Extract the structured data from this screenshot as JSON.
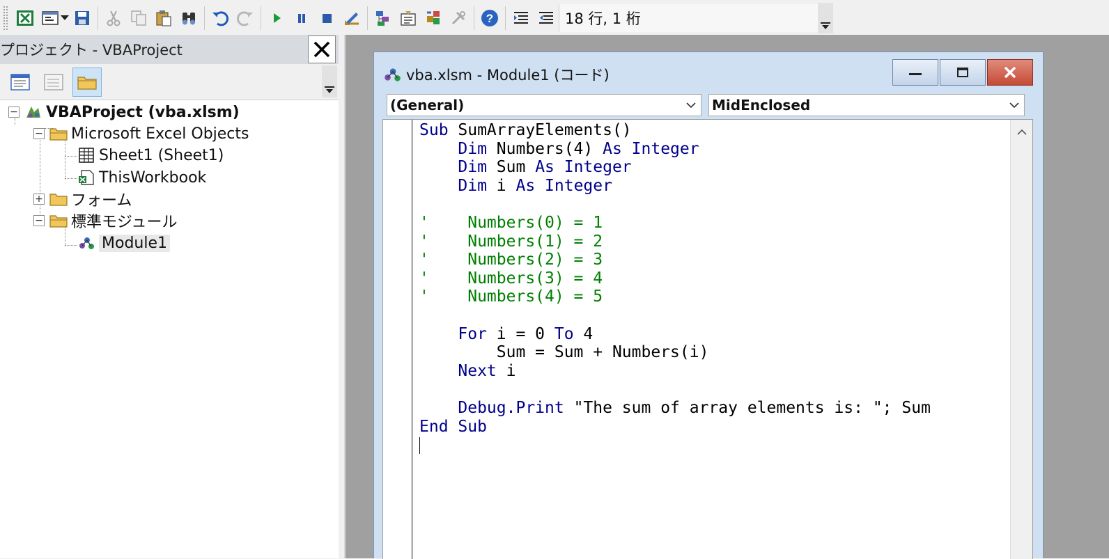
{
  "toolbar": {
    "buttons": [
      "excel-view-icon",
      "insert-userform-icon",
      "save-icon",
      "cut-icon",
      "copy-icon",
      "paste-icon",
      "find-icon",
      "undo-icon",
      "redo-icon",
      "run-icon",
      "break-icon",
      "reset-icon",
      "design-mode-icon",
      "project-explorer-icon",
      "properties-icon",
      "object-browser-icon",
      "toolbox-icon",
      "help-icon",
      "indent-icon",
      "outdent-icon"
    ],
    "position_status": "18 行, 1 桁"
  },
  "project_panel": {
    "title": "プロジェクト - VBAProject",
    "tree": {
      "root": "VBAProject (vba.xlsm)",
      "excel_objects": "Microsoft Excel Objects",
      "sheet1": "Sheet1 (Sheet1)",
      "thisworkbook": "ThisWorkbook",
      "forms": "フォーム",
      "modules": "標準モジュール",
      "module1": "Module1"
    }
  },
  "code_window": {
    "title": "vba.xlsm - Module1 (コード)",
    "object_combo": "(General)",
    "procedure_combo": "MidEnclosed",
    "lines": [
      [
        [
          "kw",
          "Sub"
        ],
        [
          "t",
          " SumArrayElements()"
        ]
      ],
      [
        [
          "t",
          "    "
        ],
        [
          "kw",
          "Dim"
        ],
        [
          "t",
          " Numbers(4) "
        ],
        [
          "kw",
          "As Integer"
        ]
      ],
      [
        [
          "t",
          "    "
        ],
        [
          "kw",
          "Dim"
        ],
        [
          "t",
          " Sum "
        ],
        [
          "kw",
          "As Integer"
        ]
      ],
      [
        [
          "t",
          "    "
        ],
        [
          "kw",
          "Dim"
        ],
        [
          "t",
          " i "
        ],
        [
          "kw",
          "As Integer"
        ]
      ],
      [
        [
          "t",
          ""
        ]
      ],
      [
        [
          "cm",
          "'    Numbers(0) = 1"
        ]
      ],
      [
        [
          "cm",
          "'    Numbers(1) = 2"
        ]
      ],
      [
        [
          "cm",
          "'    Numbers(2) = 3"
        ]
      ],
      [
        [
          "cm",
          "'    Numbers(3) = 4"
        ]
      ],
      [
        [
          "cm",
          "'    Numbers(4) = 5"
        ]
      ],
      [
        [
          "t",
          ""
        ]
      ],
      [
        [
          "t",
          "    "
        ],
        [
          "kw",
          "For"
        ],
        [
          "t",
          " i = 0 "
        ],
        [
          "kw",
          "To"
        ],
        [
          "t",
          " 4"
        ]
      ],
      [
        [
          "t",
          "        Sum = Sum + Numbers(i)"
        ]
      ],
      [
        [
          "t",
          "    "
        ],
        [
          "kw",
          "Next"
        ],
        [
          "t",
          " i"
        ]
      ],
      [
        [
          "t",
          ""
        ]
      ],
      [
        [
          "t",
          "    "
        ],
        [
          "kw",
          "Debug.Print"
        ],
        [
          "t",
          " \"The sum of array elements is: \"; Sum"
        ]
      ],
      [
        [
          "kw",
          "End Sub"
        ]
      ],
      [
        [
          "caret",
          ""
        ]
      ]
    ]
  },
  "colors": {
    "keyword": "#00008b",
    "comment": "#008000",
    "title_bar": "#cfe0f3",
    "close_button": "#c54a35"
  }
}
